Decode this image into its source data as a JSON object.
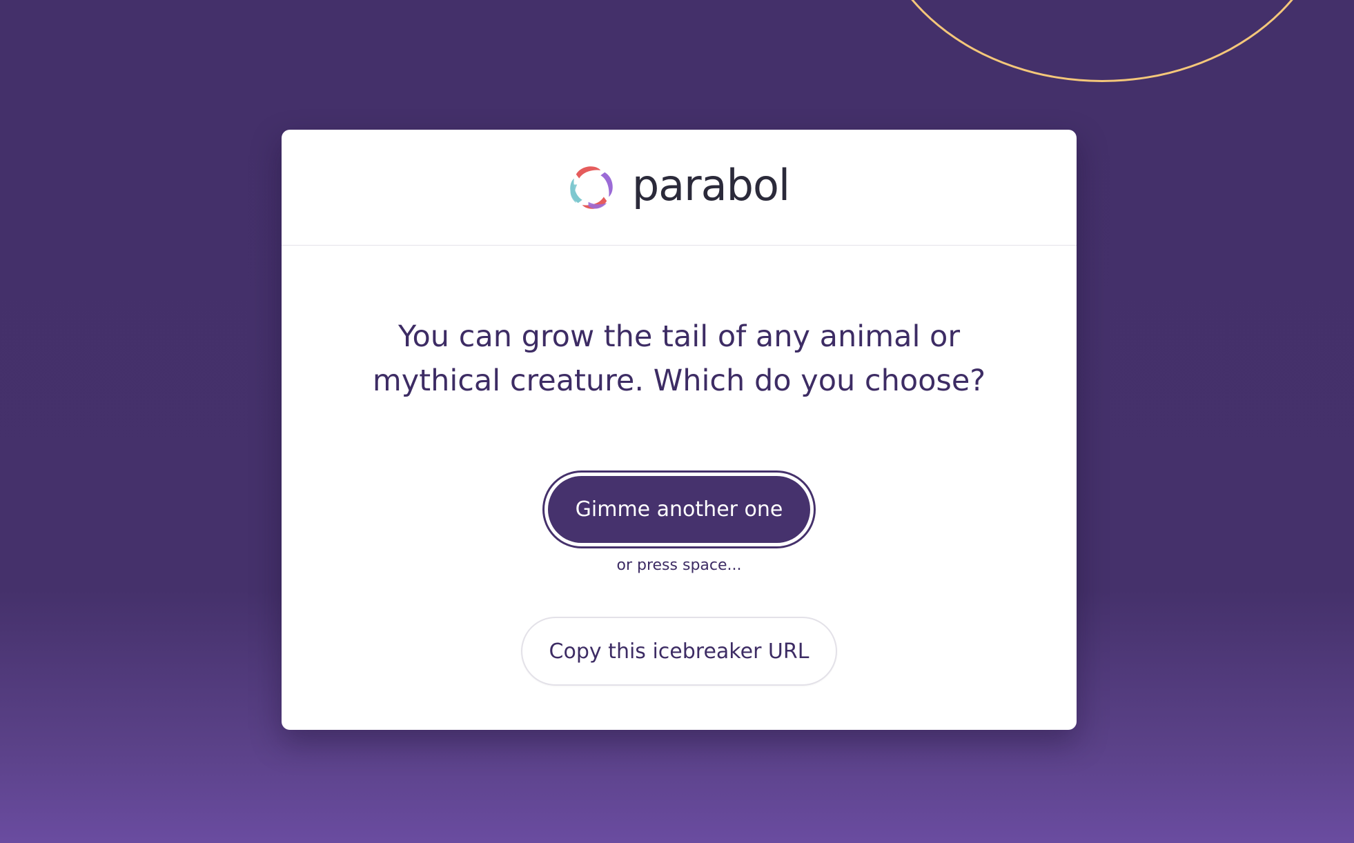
{
  "brand": {
    "name": "parabol",
    "logo_icon": "parabol-logo-icon",
    "logo_colors": [
      "#e55c5c",
      "#9b6bd6",
      "#7ec8cf"
    ]
  },
  "icebreaker": {
    "prompt": "You can grow the tail of any animal or mythical creature. Which do you choose?"
  },
  "actions": {
    "next_label": "Gimme another one",
    "hint": "or press space...",
    "copy_label": "Copy this icebreaker URL"
  },
  "colors": {
    "background": "#45316b",
    "accent_arc": "#f4c77a",
    "primary": "#46326d",
    "text": "#3d2c64"
  }
}
